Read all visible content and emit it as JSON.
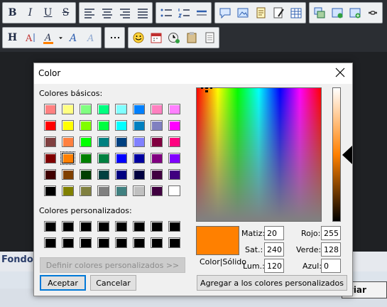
{
  "toolbar": {
    "row1": [
      [
        "bold-icon",
        "italic-icon",
        "underline-icon",
        "strikethrough-icon"
      ],
      [
        "align-left-icon",
        "align-center-icon",
        "align-right-icon",
        "align-justify-icon"
      ],
      [
        "bulleted-list-icon",
        "numbered-list-icon",
        "horizontal-rule-icon"
      ],
      [
        "comment-icon",
        "image-link-icon",
        "note-icon",
        "edit-note-icon",
        "table-icon"
      ],
      [
        "copy-format-icon",
        "insert-row-icon",
        "add-item-icon",
        "link-icon"
      ]
    ],
    "row2": [
      [
        "heading-icon",
        "text-size-icon",
        "font-color-icon",
        "dropdown-arrow-icon",
        "font-style-icon",
        "clear-format-icon"
      ],
      [
        "special-characters-icon"
      ],
      [
        "emoticon-icon",
        "calendar-icon",
        "time-icon",
        "paste-icon",
        "plain-text-icon"
      ]
    ],
    "glyphs": {
      "bold-icon": "B",
      "italic-icon": "I",
      "underline-icon": "U",
      "strikethrough-icon": "S",
      "heading-icon": "H"
    }
  },
  "page": {
    "fondo_label": "Fondo :",
    "partial_button_label": "viar"
  },
  "dialog": {
    "title": "Color",
    "basic_colors_label": "Colores básicos:",
    "custom_colors_label": "Colores personalizados:",
    "define_custom_button": "Definir colores personalizados >>",
    "accept_button": "Aceptar",
    "cancel_button": "Cancelar",
    "add_custom_button": "Agregar a los colores personalizados",
    "color_solid_label": "Color|Sólido",
    "hue_label": "Matiz:",
    "hue_value": "20",
    "sat_label": "Sat.:",
    "sat_value": "240",
    "lum_label": "Lum.:",
    "lum_value": "120",
    "red_label": "Rojo:",
    "red_value": "255",
    "green_label": "Verde:",
    "green_value": "128",
    "blue_label": "Azul:",
    "blue_value": "0",
    "current_color": "#ff8000",
    "selected_basic_index": 25,
    "basic_colors": [
      "#ff8080",
      "#ffff80",
      "#80ff80",
      "#00ff80",
      "#80ffff",
      "#0080ff",
      "#ff80c0",
      "#ff80ff",
      "#ff0000",
      "#ffff00",
      "#80ff00",
      "#00ff40",
      "#00ffff",
      "#0080c0",
      "#8080c0",
      "#ff00ff",
      "#804040",
      "#ff8040",
      "#00ff00",
      "#008080",
      "#004080",
      "#8080ff",
      "#800040",
      "#ff0080",
      "#800000",
      "#ff8000",
      "#008000",
      "#008040",
      "#0000ff",
      "#0000a0",
      "#800080",
      "#8000ff",
      "#400000",
      "#804000",
      "#004000",
      "#004040",
      "#000080",
      "#000040",
      "#400040",
      "#400080",
      "#000000",
      "#808000",
      "#808040",
      "#808080",
      "#408080",
      "#c0c0c0",
      "#400040",
      "#ffffff"
    ],
    "custom_colors": [
      "#000000",
      "#000000",
      "#000000",
      "#000000",
      "#000000",
      "#000000",
      "#000000",
      "#000000",
      "#000000",
      "#000000",
      "#000000",
      "#000000",
      "#000000",
      "#000000",
      "#000000",
      "#000000"
    ]
  }
}
